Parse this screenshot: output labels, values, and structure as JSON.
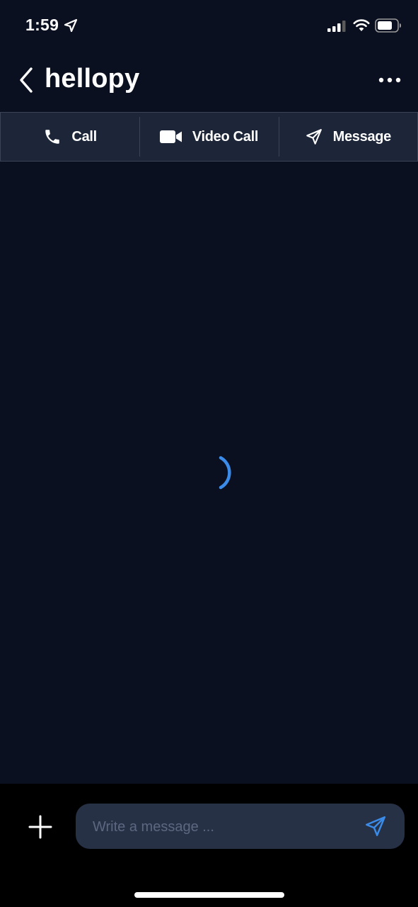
{
  "status_bar": {
    "time": "1:59",
    "icons": [
      "location-arrow-icon",
      "cellular-signal-icon",
      "wifi-icon",
      "battery-icon"
    ]
  },
  "header": {
    "title": "hellopy",
    "back_icon": "chevron-left-icon",
    "more_icon": "ellipsis-icon"
  },
  "actions": [
    {
      "label": "Call",
      "icon": "phone-icon"
    },
    {
      "label": "Video Call",
      "icon": "video-camera-icon"
    },
    {
      "label": "Message",
      "icon": "paper-plane-icon"
    }
  ],
  "content": {
    "loading": true
  },
  "composer": {
    "placeholder": "Write a message ...",
    "value": "",
    "add_icon": "plus-icon",
    "send_icon": "send-icon"
  },
  "colors": {
    "background": "#0b1020",
    "action_bar": "#1c2638",
    "input": "#273146",
    "accent": "#3b8be8",
    "composer_bg": "#000000"
  }
}
